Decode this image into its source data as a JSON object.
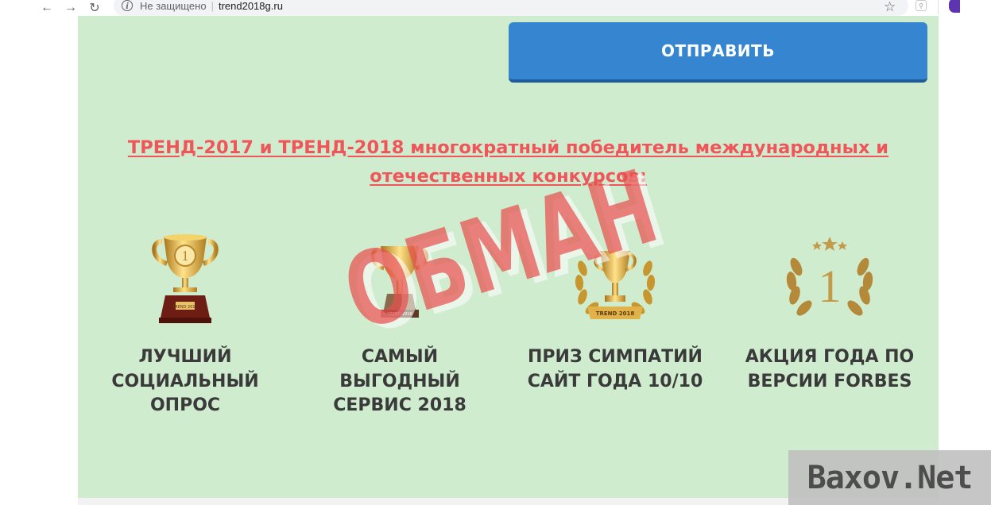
{
  "browser": {
    "back_icon": "arrow-left-icon",
    "forward_icon": "arrow-right-icon",
    "reload_icon": "reload-icon",
    "info_icon": "info-icon",
    "security_status": "Не защищено",
    "url": "trend2018g.ru",
    "bookmark_icon": "star-icon"
  },
  "form": {
    "submit_label": "ОТПРАВИТЬ"
  },
  "awards": {
    "heading_line1": "ТРЕНД-2017 и ТРЕНД-2018 многократный победитель международных и",
    "heading_line2": "отечественных конкурсов:",
    "items": [
      {
        "icon": "trophy-cup-icon",
        "line1": "ЛУЧШИЙ",
        "line2": "СОЦИАЛЬНЫЙ",
        "line3": "ОПРОС",
        "plate": "TREND 2018"
      },
      {
        "icon": "trophy-cup-icon",
        "line1": "САМЫЙ",
        "line2": "ВЫГОДНЫЙ",
        "line3": "СЕРВИС 2018",
        "plate": "TREND 2018"
      },
      {
        "icon": "laurel-trophy-icon",
        "line1": "ПРИЗ СИМПАТИЙ",
        "line2": "САЙТ ГОДА 10/10",
        "line3": "",
        "plate": "TREND 2018"
      },
      {
        "icon": "laurel-number-one-icon",
        "line1": "АКЦИЯ ГОДА ПО",
        "line2": "ВЕРСИИ FORBES",
        "line3": "",
        "plate": "1"
      }
    ]
  },
  "overlay": {
    "stamp_text": "ОБМАН",
    "watermark_text": "Baxov.Net"
  },
  "colors": {
    "page_bg": "#d0ecce",
    "button_bg": "#3585d0",
    "heading": "#f0555a",
    "label": "#3a3a3a",
    "stamp": "#e8514f"
  }
}
